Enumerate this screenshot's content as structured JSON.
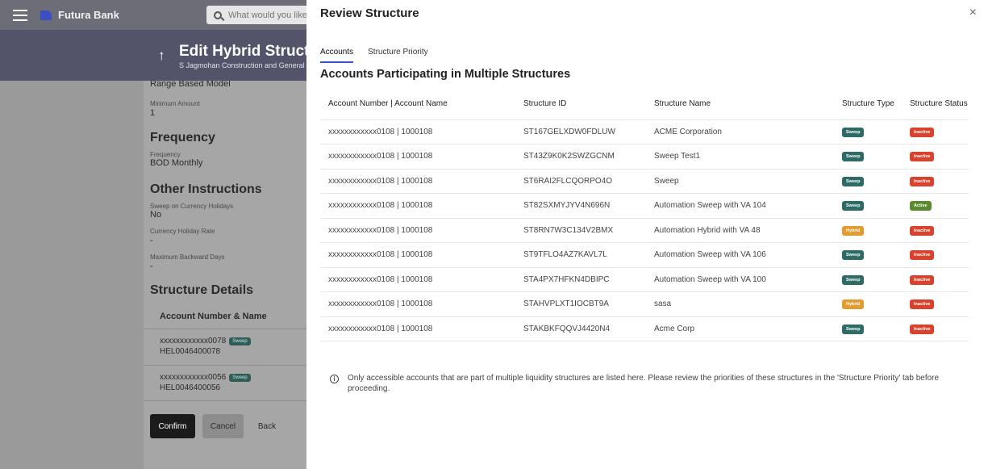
{
  "app": {
    "brand_name": "Futura Bank",
    "brand_color": "#3b4fc0"
  },
  "search": {
    "placeholder": "What would you like"
  },
  "page": {
    "title": "Edit Hybrid Structu",
    "subtitle": "S Jagmohan Construction and General S"
  },
  "left": {
    "model_value": "Range Based Model",
    "min_amount_label": "Minimum Amount",
    "min_amount_value": "1",
    "frequency_heading": "Frequency",
    "frequency_label": "Frequency",
    "frequency_value": "BOD Monthly",
    "other_heading": "Other Instructions",
    "sweep_holiday_label": "Sweep on Currency Holidays",
    "sweep_holiday_value": "No",
    "holiday_rate_label": "Currency Holiday Rate",
    "holiday_rate_value": "-",
    "max_backward_label": "Maximum Backward Days",
    "max_backward_value": "-",
    "structure_heading": "Structure Details",
    "acc_col_header": "Account Number & Name",
    "accounts": [
      {
        "number": "xxxxxxxxxxxx0078",
        "badge": "Sweep",
        "name": "HEL0046400078"
      },
      {
        "number": "xxxxxxxxxxxx0056",
        "badge": "Sweep",
        "name": "HEL0046400056"
      }
    ],
    "confirm_label": "Confirm",
    "cancel_label": "Cancel",
    "back_label": "Back"
  },
  "modal": {
    "title": "Review Structure",
    "close_glyph": "×",
    "tabs": [
      {
        "label": "Accounts",
        "active": true
      },
      {
        "label": "Structure Priority",
        "active": false
      }
    ],
    "section_title": "Accounts Participating in Multiple Structures",
    "columns": [
      "Account Number | Account Name",
      "Structure ID",
      "Structure Name",
      "Structure Type",
      "Structure Status"
    ],
    "rows": [
      {
        "account": "xxxxxxxxxxxx0108 | 1000108",
        "id": "ST167GELXDW0FDLUW",
        "name": "ACME Corporation",
        "type": "Sweep",
        "status": "Inactive"
      },
      {
        "account": "xxxxxxxxxxxx0108 | 1000108",
        "id": "ST43Z9K0K2SWZGCNM",
        "name": "Sweep Test1",
        "type": "Sweep",
        "status": "Inactive"
      },
      {
        "account": "xxxxxxxxxxxx0108 | 1000108",
        "id": "ST6RAI2FLCQORPO4O",
        "name": "Sweep",
        "type": "Sweep",
        "status": "Inactive"
      },
      {
        "account": "xxxxxxxxxxxx0108 | 1000108",
        "id": "ST82SXMYJYV4N696N",
        "name": "Automation Sweep with VA 104",
        "type": "Sweep",
        "status": "Active"
      },
      {
        "account": "xxxxxxxxxxxx0108 | 1000108",
        "id": "ST8RN7W3C134V2BMX",
        "name": "Automation Hybrid with VA 48",
        "type": "Hybrid",
        "status": "Inactive"
      },
      {
        "account": "xxxxxxxxxxxx0108 | 1000108",
        "id": "ST9TFLO4AZ7KAVL7L",
        "name": "Automation Sweep with VA 106",
        "type": "Sweep",
        "status": "Inactive"
      },
      {
        "account": "xxxxxxxxxxxx0108 | 1000108",
        "id": "STA4PX7HFKN4DBIPC",
        "name": "Automation Sweep with VA 100",
        "type": "Sweep",
        "status": "Inactive"
      },
      {
        "account": "xxxxxxxxxxxx0108 | 1000108",
        "id": "STAHVPLXT1IOCBT9A",
        "name": "sasa",
        "type": "Hybrid",
        "status": "Inactive"
      },
      {
        "account": "xxxxxxxxxxxx0108 | 1000108",
        "id": "STAKBKFQQVJ4420N4",
        "name": "Acme Corp",
        "type": "Sweep",
        "status": "Inactive"
      }
    ],
    "info_text": "Only accessible accounts that are part of multiple liquidity structures are listed here. Please review the priorities of these structures in the 'Structure Priority' tab before proceeding."
  },
  "colors": {
    "sweep": "#2d6b66",
    "hybrid": "#e39b2f",
    "inactive": "#d9422c",
    "active": "#5b8b2f",
    "tab_underline": "#3b55c9"
  }
}
